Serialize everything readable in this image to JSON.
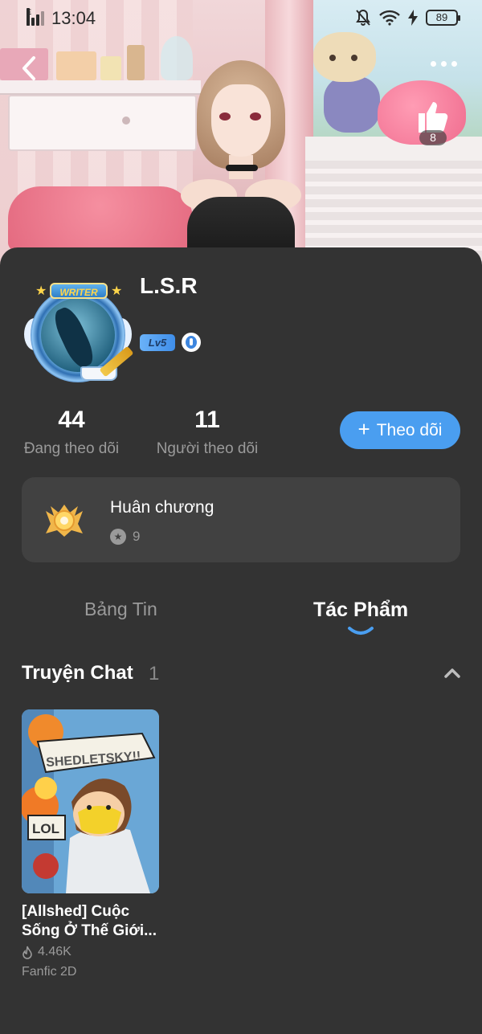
{
  "status_bar": {
    "time": "13:04",
    "network": "E",
    "battery": "89"
  },
  "header": {
    "like_count": "8"
  },
  "profile": {
    "name": "L.S.R",
    "level": "Lv5",
    "avatar_frame_label": "WRITER",
    "following_count": "44",
    "following_label": "Đang theo dõi",
    "followers_count": "11",
    "followers_label": "Người theo dõi",
    "follow_button": "Theo dõi"
  },
  "medals": {
    "title": "Huân chương",
    "count": "9"
  },
  "tabs": [
    {
      "label": "Bảng Tin",
      "active": false
    },
    {
      "label": "Tác Phẩm",
      "active": true
    }
  ],
  "section": {
    "title": "Truyện Chat",
    "count": "1"
  },
  "stories": [
    {
      "title": "[Allshed] Cuộc Sống Ở Thế Giới...",
      "views": "4.46K",
      "genre": "Fanfic 2D",
      "cover_texts": [
        "SHEDLETSKY!!",
        "LOL"
      ]
    }
  ],
  "colors": {
    "accent": "#4a9ef0",
    "background": "#333333",
    "card": "#414141",
    "muted_text": "#9a9a9a"
  },
  "icons": {
    "back": "chevron-left-icon",
    "more": "more-dots-icon",
    "like": "thumbs-up-icon",
    "medal": "medal-icon",
    "collapse": "chevron-up-icon",
    "views": "flame-icon"
  }
}
